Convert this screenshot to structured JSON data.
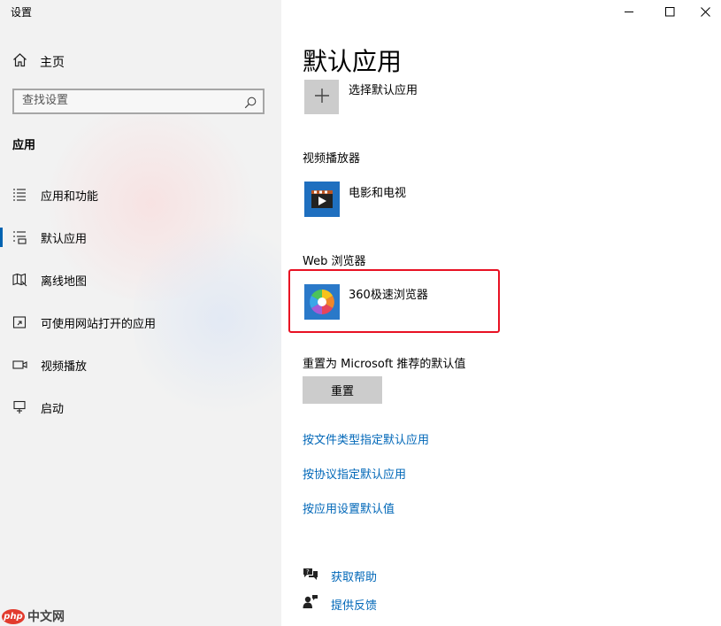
{
  "window": {
    "title": "设置",
    "minimize_icon": "minimize-icon",
    "maximize_icon": "maximize-icon",
    "close_icon": "close-icon"
  },
  "sidebar": {
    "home_label": "主页",
    "search_placeholder": "查找设置",
    "section_title": "应用",
    "items": [
      {
        "label": "应用和功能",
        "icon": "apps-features-icon",
        "selected": false
      },
      {
        "label": "默认应用",
        "icon": "default-apps-icon",
        "selected": true
      },
      {
        "label": "离线地图",
        "icon": "offline-maps-icon",
        "selected": false
      },
      {
        "label": "可使用网站打开的应用",
        "icon": "apps-for-websites-icon",
        "selected": false
      },
      {
        "label": "视频播放",
        "icon": "video-playback-icon",
        "selected": false
      },
      {
        "label": "启动",
        "icon": "startup-icon",
        "selected": false
      }
    ]
  },
  "main": {
    "title": "默认应用",
    "choose_default_label": "选择默认应用",
    "video_player_heading": "视频播放器",
    "video_player_app": "电影和电视",
    "web_browser_heading": "Web 浏览器",
    "web_browser_app": "360极速浏览器",
    "reset_heading": "重置为 Microsoft 推荐的默认值",
    "reset_button": "重置",
    "links": [
      "按文件类型指定默认应用",
      "按协议指定默认应用",
      "按应用设置默认值"
    ],
    "help_links": [
      {
        "label": "获取帮助",
        "icon": "get-help-icon"
      },
      {
        "label": "提供反馈",
        "icon": "feedback-icon"
      }
    ]
  },
  "watermark": {
    "badge": "php",
    "text": "中文网"
  },
  "colors": {
    "sidebar_bg": "#f2f2f2",
    "accent": "#0063b1",
    "link": "#0067b8",
    "highlight_border": "#e81123",
    "tile_gray": "#cccccc"
  }
}
